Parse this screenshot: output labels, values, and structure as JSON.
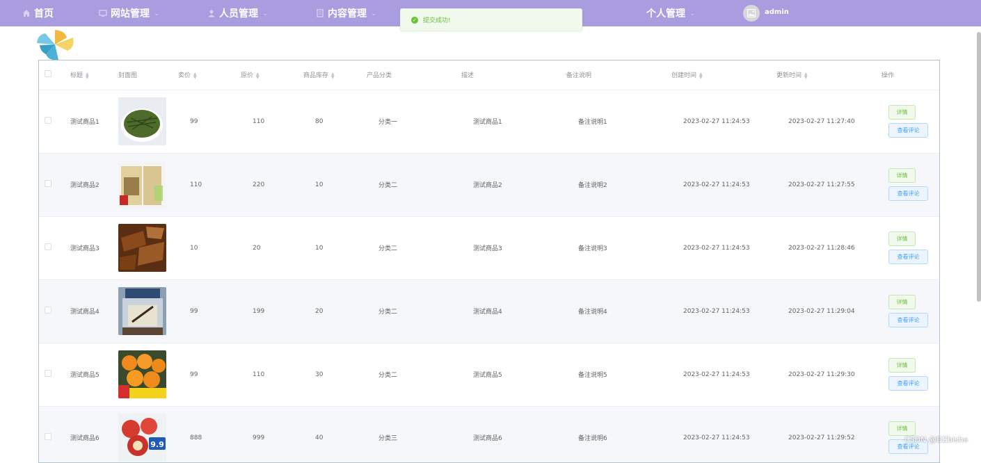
{
  "nav": {
    "items": [
      {
        "label": "首页",
        "icon": "home-icon"
      },
      {
        "label": "网站管理",
        "icon": "monitor-icon"
      },
      {
        "label": "人员管理",
        "icon": "user-icon"
      },
      {
        "label": "内容管理",
        "icon": "document-icon"
      },
      {
        "label": "个人管理",
        "icon": "none"
      }
    ],
    "user": "admin"
  },
  "toast": {
    "message": "提交成功!",
    "color": "#67c23a"
  },
  "colors": {
    "nav_bg": "#a99de0",
    "success": "#67c23a",
    "primary": "#409eff"
  },
  "table": {
    "columns": [
      "标题",
      "封面图",
      "卖价",
      "原价",
      "商品库存",
      "产品分类",
      "描述",
      "备注说明",
      "创建时间",
      "更新时间",
      "操作"
    ],
    "rows": [
      {
        "title": "测试商品1",
        "image": "green-tea-image",
        "price": "99",
        "original": "110",
        "stock": "80",
        "category": "分类一",
        "desc": "测试商品1",
        "note": "备注说明1",
        "created": "2023-02-27 11:24:53",
        "updated": "2023-02-27 11:27:40"
      },
      {
        "title": "测试商品2",
        "image": "tea-box-image",
        "price": "110",
        "original": "220",
        "stock": "10",
        "category": "分类二",
        "desc": "测试商品2",
        "note": "备注说明2",
        "created": "2023-02-27 11:24:53",
        "updated": "2023-02-27 11:27:55"
      },
      {
        "title": "测试商品3",
        "image": "dried-meat-image",
        "price": "10",
        "original": "20",
        "stock": "10",
        "category": "分类二",
        "desc": "测试商品3",
        "note": "备注说明3",
        "created": "2023-02-27 11:24:53",
        "updated": "2023-02-27 11:28:46"
      },
      {
        "title": "测试商品4",
        "image": "jar-image",
        "price": "99",
        "original": "199",
        "stock": "20",
        "category": "分类二",
        "desc": "测试商品4",
        "note": "备注说明4",
        "created": "2023-02-27 11:24:53",
        "updated": "2023-02-27 11:29:04"
      },
      {
        "title": "测试商品5",
        "image": "oranges-image",
        "price": "99",
        "original": "110",
        "stock": "30",
        "category": "分类二",
        "desc": "测试商品5",
        "note": "备注说明5",
        "created": "2023-02-27 11:24:53",
        "updated": "2023-02-27 11:29:30"
      },
      {
        "title": "测试商品6",
        "image": "apples-image",
        "price": "888",
        "original": "999",
        "stock": "40",
        "category": "分类三",
        "desc": "测试商品6",
        "note": "备注说明6",
        "created": "2023-02-27 11:24:53",
        "updated": "2023-02-27 11:29:52"
      }
    ],
    "actions": {
      "detail": "详情",
      "review": "查看评论"
    }
  },
  "watermark": "CSDN @DZbishe"
}
